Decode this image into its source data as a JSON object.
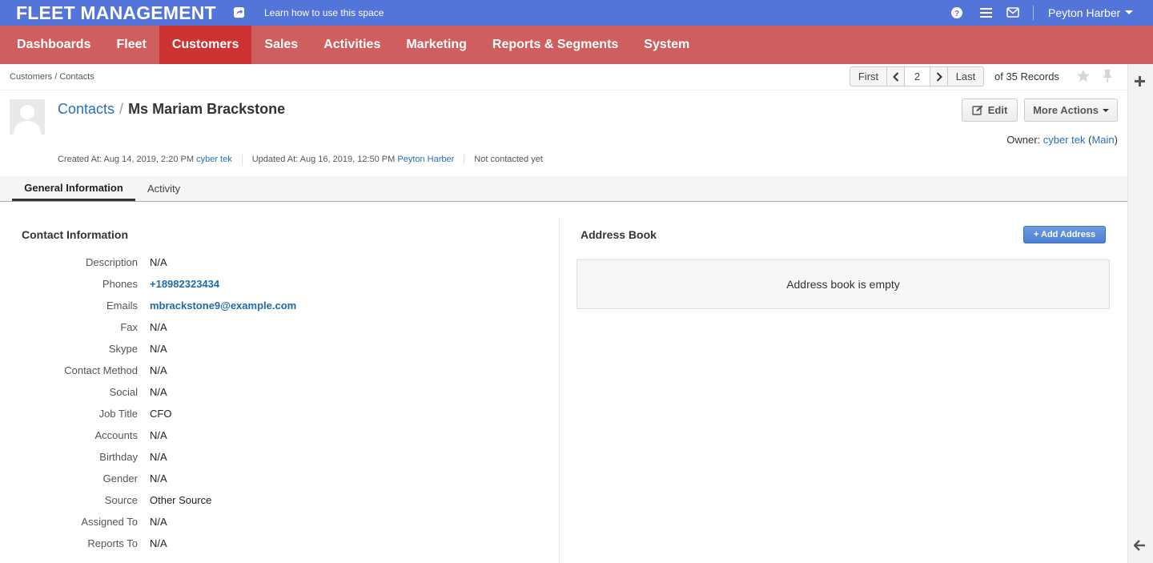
{
  "topbar": {
    "brand": "FLEET MANAGEMENT",
    "learn_link": "Learn how to use this space",
    "user_name": "Peyton Harber",
    "icons": [
      "share-icon",
      "help-icon",
      "menu-icon",
      "mail-icon"
    ]
  },
  "nav": {
    "items": [
      "Dashboards",
      "Fleet",
      "Customers",
      "Sales",
      "Activities",
      "Marketing",
      "Reports & Segments",
      "System"
    ],
    "active": "Customers"
  },
  "breadcrumb": "Customers / Contacts",
  "pager": {
    "first": "First",
    "page": "2",
    "last": "Last",
    "records": "of 35 Records"
  },
  "header": {
    "section_link": "Contacts",
    "separator": "/",
    "record_name": "Ms Mariam Brackstone",
    "edit_label": "Edit",
    "more_actions_label": "More Actions",
    "owner_label": "Owner:",
    "owner_name": "cyber tek",
    "owner_unit": "Main",
    "created_label": "Created At: Aug 14, 2019, 2:20 PM",
    "created_by": "cyber tek",
    "updated_label": "Updated At: Aug 16, 2019, 12:50 PM",
    "updated_by": "Peyton Harber",
    "contacted": "Not contacted yet"
  },
  "tabs": {
    "general": "General Information",
    "activity": "Activity"
  },
  "contact_info": {
    "title": "Contact Information",
    "fields": [
      {
        "label": "Description",
        "value": "N/A",
        "link": false
      },
      {
        "label": "Phones",
        "value": "+18982323434",
        "link": true
      },
      {
        "label": "Emails",
        "value": "mbrackstone9@example.com",
        "link": true
      },
      {
        "label": "Fax",
        "value": "N/A",
        "link": false
      },
      {
        "label": "Skype",
        "value": "N/A",
        "link": false
      },
      {
        "label": "Contact Method",
        "value": "N/A",
        "link": false
      },
      {
        "label": "Social",
        "value": "N/A",
        "link": false
      },
      {
        "label": "Job Title",
        "value": "CFO",
        "link": false
      },
      {
        "label": "Accounts",
        "value": "N/A",
        "link": false
      },
      {
        "label": "Birthday",
        "value": "N/A",
        "link": false
      },
      {
        "label": "Gender",
        "value": "N/A",
        "link": false
      },
      {
        "label": "Source",
        "value": "Other Source",
        "link": false
      },
      {
        "label": "Assigned To",
        "value": "N/A",
        "link": false
      },
      {
        "label": "Reports To",
        "value": "N/A",
        "link": false
      }
    ]
  },
  "address_book": {
    "title": "Address Book",
    "add_label": "+ Add Address",
    "empty_text": "Address book is empty"
  },
  "colors": {
    "topbar": "#5374d9",
    "nav": "#cf5f5f",
    "nav_active": "#cc3333",
    "link": "#2a6fb8"
  }
}
